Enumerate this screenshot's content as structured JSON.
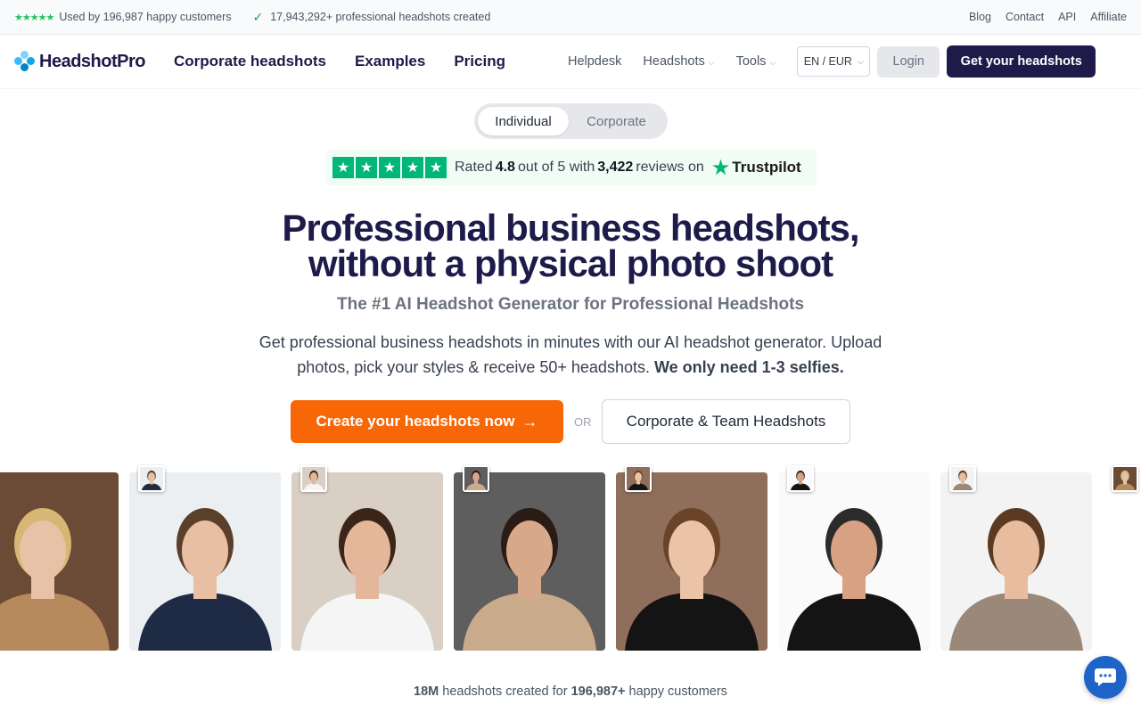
{
  "topbar": {
    "customers_text": "Used by 196,987 happy customers",
    "created_text": "17,943,292+ professional headshots created",
    "links": [
      "Blog",
      "Contact",
      "API",
      "Affiliate"
    ]
  },
  "nav": {
    "brand": "HeadshotPro",
    "main_links": [
      "Corporate headshots",
      "Examples",
      "Pricing"
    ],
    "helpdesk": "Helpdesk",
    "headshots": "Headshots",
    "tools": "Tools",
    "locale": "EN / EUR",
    "login": "Login",
    "cta": "Get your headshots"
  },
  "toggle": {
    "options": [
      "Individual",
      "Corporate"
    ],
    "selected": "Individual"
  },
  "trustpilot": {
    "prefix": "Rated",
    "rating": "4.8",
    "mid": "out of 5 with",
    "count": "3,422",
    "suffix": "reviews on",
    "brand": "Trustpilot"
  },
  "hero": {
    "title_line1": "Professional business headshots,",
    "title_line2": "without a physical photo shoot",
    "subtitle": "The #1 AI Headshot Generator for Professional Headshots",
    "description": "Get professional business headshots in minutes with our AI headshot generator. Upload photos, pick your styles & receive 50+ headshots.",
    "description_bold": "We only need 1-3 selfies.",
    "primary_cta": "Create your headshots now",
    "or": "OR",
    "secondary_cta": "Corporate & Team Headshots"
  },
  "photos": [
    {
      "bg": "#6b4a36",
      "skin": "#e8c2a6",
      "hair": "#d8b774",
      "cloth": "#b68a5c"
    },
    {
      "bg": "#eceff1",
      "skin": "#e9bfa3",
      "hair": "#5a3f2a",
      "cloth": "#1f2b45"
    },
    {
      "bg": "#d9cfc4",
      "skin": "#e5b79a",
      "hair": "#3a2518",
      "cloth": "#f5f5f5"
    },
    {
      "bg": "#5e5e5e",
      "skin": "#d8a88b",
      "hair": "#2a1c14",
      "cloth": "#c9ab8c"
    },
    {
      "bg": "#8f6f5b",
      "skin": "#ebc3a7",
      "hair": "#6a4328",
      "cloth": "#141414"
    },
    {
      "bg": "#fafafa",
      "skin": "#d9a184",
      "hair": "#2b2b2b",
      "cloth": "#141414"
    },
    {
      "bg": "#f3f3f3",
      "skin": "#e8bc9e",
      "hair": "#5b3a22",
      "cloth": "#9a8878"
    }
  ],
  "stats": {
    "count": "18M",
    "mid": "headshots created for",
    "customers": "196,987+",
    "suffix": "happy customers"
  },
  "colors": {
    "brand_navy": "#1e1b4b",
    "cta_orange": "#f76707",
    "trustpilot_green": "#00b67a",
    "chat_blue": "#1e64c8"
  }
}
